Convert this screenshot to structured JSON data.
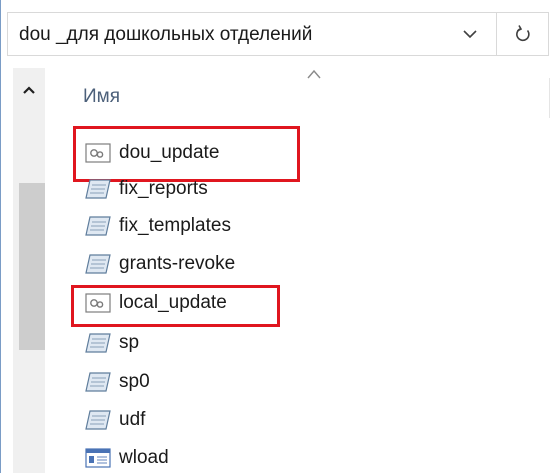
{
  "address_bar": {
    "path": "dou _для дошкольных отделений",
    "icons": {
      "dropdown": "chevron-down-icon",
      "refresh": "refresh-icon"
    }
  },
  "list_header": {
    "name_column": "Имя",
    "sort": "ascending"
  },
  "files": [
    {
      "name": "dou_update",
      "icon": "settings-file-icon",
      "highlighted": true
    },
    {
      "name": "fix_reports",
      "icon": "text-file-icon",
      "highlighted": false
    },
    {
      "name": "fix_templates",
      "icon": "text-file-icon",
      "highlighted": false
    },
    {
      "name": "grants-revoke",
      "icon": "text-file-icon",
      "highlighted": false
    },
    {
      "name": "local_update",
      "icon": "settings-file-icon",
      "highlighted": true
    },
    {
      "name": "sp",
      "icon": "text-file-icon",
      "highlighted": false
    },
    {
      "name": "sp0",
      "icon": "text-file-icon",
      "highlighted": false
    },
    {
      "name": "udf",
      "icon": "text-file-icon",
      "highlighted": false
    },
    {
      "name": "wload",
      "icon": "form-file-icon",
      "highlighted": false
    }
  ],
  "colors": {
    "highlight": "#e0161f",
    "header_text": "#4c607a",
    "window_border": "#7a9cc6"
  }
}
